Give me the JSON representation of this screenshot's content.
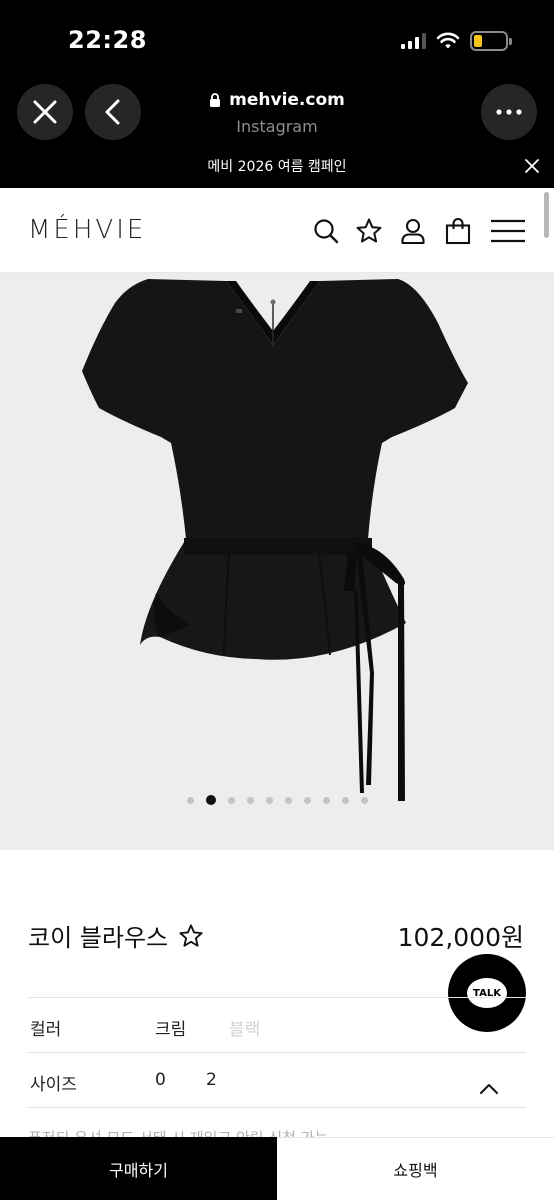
{
  "status_bar": {
    "time": "22:28"
  },
  "browser": {
    "url": "mehvie.com",
    "source": "Instagram",
    "close_icon": "close-icon",
    "back_icon": "chevron-left-icon",
    "more_icon": "more-horizontal-icon",
    "lock_icon": "lock-icon"
  },
  "banner": {
    "text": "메비 2026 여름 캠페인"
  },
  "header": {
    "logo": "MÉHVIE",
    "icons": [
      "search-icon",
      "star-icon",
      "user-icon",
      "bag-icon",
      "menu-icon"
    ]
  },
  "gallery": {
    "image_count": 10,
    "active_index": 1
  },
  "product": {
    "name": "코이 블라우스",
    "price": "102,000원",
    "color_label": "컬러",
    "colors": [
      "크림",
      "블랙"
    ],
    "size_label": "사이즈",
    "sizes": [
      "0",
      "2"
    ],
    "description_preview": "푸저되 우셔 므드 서태 시 재입고 안림 신청 가능"
  },
  "chat": {
    "label": "TALK"
  },
  "actions": {
    "buy_label": "구매하기",
    "bag_label": "쇼핑백"
  },
  "colors": {
    "chrome_bg": "#000000",
    "hero_bg": "#ededed",
    "accent": "#111111"
  }
}
